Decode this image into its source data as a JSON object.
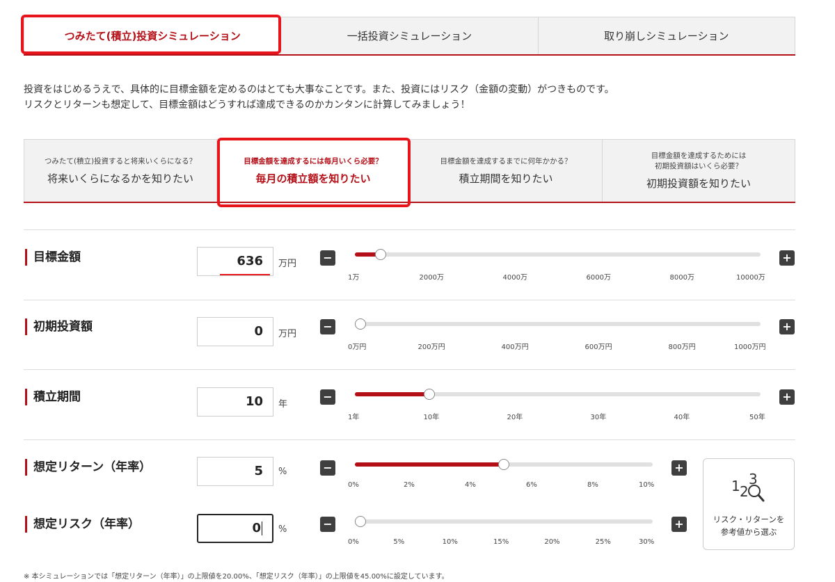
{
  "top_tabs": [
    {
      "label": "つみたて(積立)投資シミュレーション",
      "active": true
    },
    {
      "label": "一括投資シミュレーション",
      "active": false
    },
    {
      "label": "取り崩しシミュレーション",
      "active": false
    }
  ],
  "intro": {
    "line1": "投資をはじめるうえで、具体的に目標金額を定めるのはとても大事なことです。また、投資にはリスク（金額の変動）がつきものです。",
    "line2": "リスクとリターンも想定して、目標金額はどうすれば達成できるのかカンタンに計算してみましょう！"
  },
  "mode_tabs": [
    {
      "sub": "つみたて(積立)投資すると将来いくらになる？",
      "main": "将来いくらになるかを知りたい",
      "active": false
    },
    {
      "sub": "目標金額を達成するには毎月いくら必要？",
      "main": "毎月の積立額を知りたい",
      "active": true
    },
    {
      "sub": "目標金額を達成するまでに何年かかる？",
      "main": "積立期間を知りたい",
      "active": false
    },
    {
      "sub": "目標金額を達成するためには\n初期投資額はいくら必要？",
      "main": "初期投資額を知りたい",
      "active": false
    }
  ],
  "fields": {
    "target": {
      "label": "目標金額",
      "value": "636",
      "unit": "万円",
      "slider_fraction": 0.0635,
      "ticks": [
        "1万",
        "2000万",
        "4000万",
        "6000万",
        "8000万",
        "10000万"
      ]
    },
    "initial": {
      "label": "初期投資額",
      "value": "0",
      "unit": "万円",
      "slider_fraction": 0.0,
      "ticks": [
        "0万円",
        "200万円",
        "400万円",
        "600万円",
        "800万円",
        "1000万円"
      ]
    },
    "period": {
      "label": "積立期間",
      "value": "10",
      "unit": "年",
      "slider_fraction": 0.1837,
      "ticks": [
        "1年",
        "10年",
        "20年",
        "30年",
        "40年",
        "50年"
      ]
    },
    "return": {
      "label": "想定リターン（年率）",
      "value": "5",
      "unit": "%",
      "slider_fraction": 0.5,
      "ticks": [
        "0%",
        "2%",
        "4%",
        "6%",
        "8%",
        "10%"
      ]
    },
    "risk": {
      "label": "想定リスク（年率）",
      "value": "0",
      "unit": "%",
      "slider_fraction": 0.0,
      "ticks": [
        "0%",
        "5%",
        "10%",
        "15%",
        "20%",
        "25%",
        "30%"
      ]
    }
  },
  "buttons": {
    "minus": "−",
    "plus": "+"
  },
  "reference": {
    "digit1": "1",
    "digit2": "2",
    "digit3": "3",
    "text": "リスク・リターンを\n参考値から選ぶ"
  },
  "footnote": "※ 本シミュレーションでは「想定リターン（年率）」の上限値を20.00%、「想定リスク（年率）」の上限値を45.00%に設定しています。",
  "colors": {
    "accent": "#b40f17",
    "highlight": "#e8141c"
  }
}
